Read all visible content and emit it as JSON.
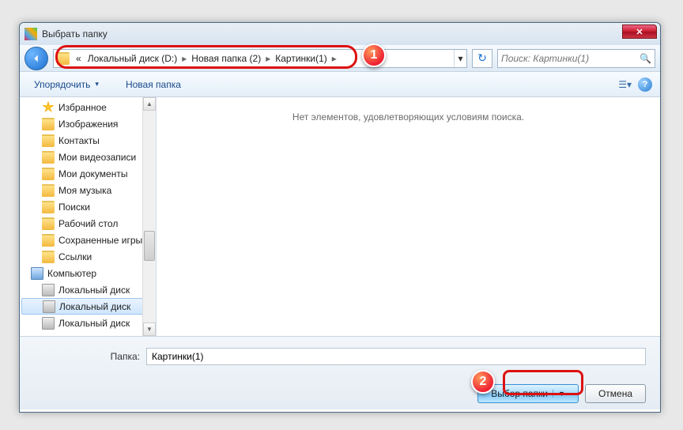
{
  "window": {
    "title": "Выбрать папку"
  },
  "breadcrumb": {
    "prefix": "«",
    "seg1": "Локальный диск (D:)",
    "seg2": "Новая папка (2)",
    "seg3": "Картинки(1)"
  },
  "search": {
    "placeholder": "Поиск: Картинки(1)"
  },
  "toolbar": {
    "organize": "Упорядочить",
    "newfolder": "Новая папка"
  },
  "sidebar": {
    "items": [
      {
        "label": "Избранное",
        "icon": "star-y",
        "lvl": 2
      },
      {
        "label": "Изображения",
        "icon": "folder-y",
        "lvl": 2
      },
      {
        "label": "Контакты",
        "icon": "folder-y",
        "lvl": 2
      },
      {
        "label": "Мои видеозаписи",
        "icon": "folder-y",
        "lvl": 2
      },
      {
        "label": "Мои документы",
        "icon": "folder-y",
        "lvl": 2
      },
      {
        "label": "Моя музыка",
        "icon": "folder-y",
        "lvl": 2
      },
      {
        "label": "Поиски",
        "icon": "folder-y",
        "lvl": 2
      },
      {
        "label": "Рабочий стол",
        "icon": "folder-y",
        "lvl": 2
      },
      {
        "label": "Сохраненные игры",
        "icon": "folder-y",
        "lvl": 2
      },
      {
        "label": "Ссылки",
        "icon": "folder-y",
        "lvl": 2
      },
      {
        "label": "Компьютер",
        "icon": "pc-icon",
        "lvl": 1
      },
      {
        "label": "Локальный диск",
        "icon": "disk-icon",
        "lvl": 2
      },
      {
        "label": "Локальный диск",
        "icon": "disk-icon",
        "lvl": 2,
        "sel": true
      },
      {
        "label": "Локальный диск",
        "icon": "disk-icon",
        "lvl": 2
      }
    ]
  },
  "content": {
    "empty": "Нет элементов, удовлетворяющих условиям поиска."
  },
  "footer": {
    "folder_label": "Папка:",
    "folder_value": "Картинки(1)",
    "select_btn": "Выбор папки",
    "cancel_btn": "Отмена"
  },
  "markers": {
    "m1": "1",
    "m2": "2"
  }
}
